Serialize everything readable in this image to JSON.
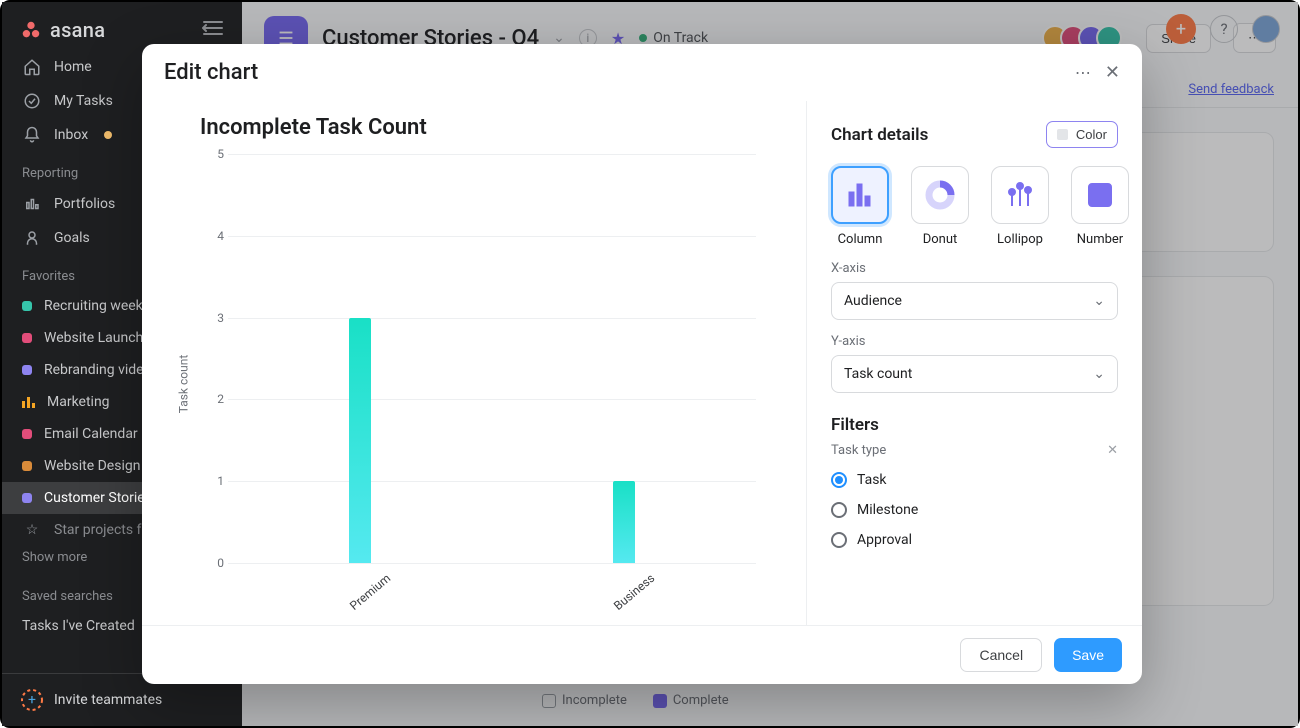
{
  "brand": {
    "name": "asana"
  },
  "nav": {
    "home": "Home",
    "mytasks": "My Tasks",
    "inbox": "Inbox",
    "reporting_label": "Reporting",
    "portfolios": "Portfolios",
    "goals": "Goals"
  },
  "favorites": {
    "label": "Favorites",
    "items": [
      {
        "label": "Recruiting weekly",
        "color": "#36c5ab"
      },
      {
        "label": "Website Launch",
        "color": "#e24d7a"
      },
      {
        "label": "Rebranding video",
        "color": "#8e84f0"
      },
      {
        "label": "Marketing",
        "color": "bars"
      },
      {
        "label": "Email Calendar",
        "color": "#e24d7a"
      },
      {
        "label": "Website Design",
        "color": "#d98b3a"
      },
      {
        "label": "Customer Stories",
        "color": "#8e84f0"
      }
    ],
    "star_row": "Star projects for easy access",
    "show_more": "Show more"
  },
  "saved": {
    "label": "Saved searches",
    "item": "Tasks I've Created"
  },
  "invite": "Invite teammates",
  "header": {
    "project": "Customer Stories - Q4",
    "status": "On Track",
    "share": "Share",
    "feedback": "Send feedback"
  },
  "background_legend": {
    "incomplete": "Incomplete",
    "complete": "Complete"
  },
  "modal": {
    "title": "Edit chart",
    "chart_title": "Incomplete Task Count",
    "y_axis_caption": "Task count",
    "details_title": "Chart details",
    "color_btn": "Color",
    "types": {
      "column": "Column",
      "donut": "Donut",
      "lollipop": "Lollipop",
      "number": "Number"
    },
    "xaxis_label": "X-axis",
    "xaxis_value": "Audience",
    "yaxis_label": "Y-axis",
    "yaxis_value": "Task count",
    "filters_title": "Filters",
    "filter_name": "Task type",
    "radios": {
      "task": "Task",
      "milestone": "Milestone",
      "approval": "Approval"
    },
    "cancel": "Cancel",
    "save": "Save"
  },
  "chart_data": {
    "type": "bar",
    "title": "Incomplete Task Count",
    "ylabel": "Task count",
    "xlabel": "",
    "ylim": [
      0,
      5
    ],
    "ticks": [
      0,
      1,
      2,
      3,
      4,
      5
    ],
    "categories": [
      "Premium",
      "Business"
    ],
    "values": [
      3,
      1
    ]
  }
}
